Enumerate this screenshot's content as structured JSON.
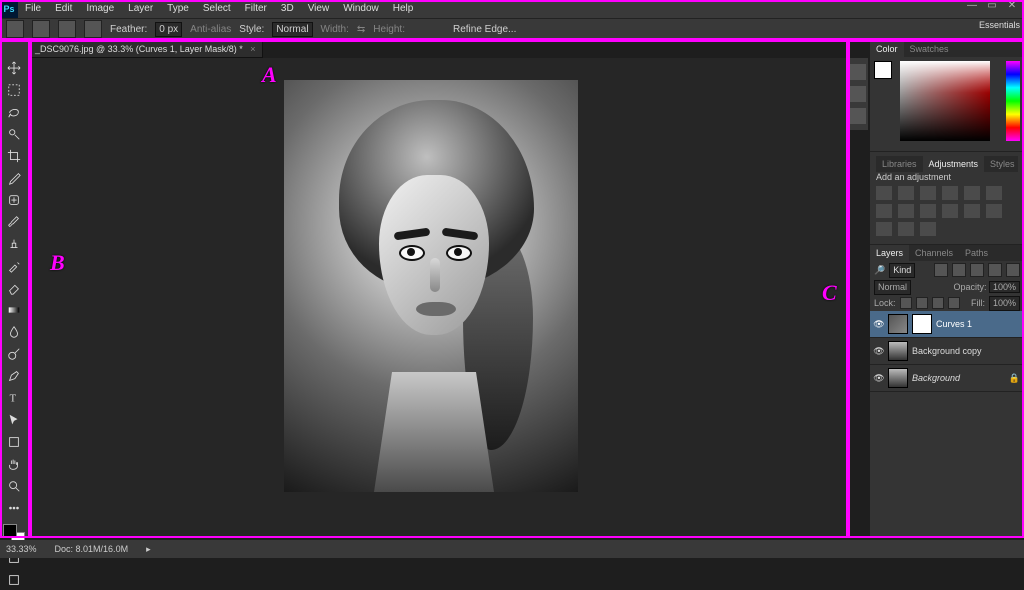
{
  "menu": [
    "File",
    "Edit",
    "Image",
    "Layer",
    "Type",
    "Select",
    "Filter",
    "3D",
    "View",
    "Window",
    "Help"
  ],
  "workspace": "Essentials",
  "options": {
    "feather_label": "Feather:",
    "feather_value": "0 px",
    "anti_alias": "Anti-alias",
    "style_label": "Style:",
    "style_value": "Normal",
    "width_label": "Width:",
    "height_label": "Height:",
    "refine": "Refine Edge..."
  },
  "doc_tab": "_DSC9076.jpg @ 33.3% (Curves 1, Layer Mask/8) *",
  "annotations": {
    "A": "A",
    "B": "B",
    "C": "C"
  },
  "iconstrip": [
    "history-icon",
    "actions-icon",
    "properties-icon"
  ],
  "color_panel": {
    "tabs": [
      "Color",
      "Swatches"
    ],
    "active": 0
  },
  "adjust_panel": {
    "tabs": [
      "Libraries",
      "Adjustments",
      "Styles"
    ],
    "active": 1,
    "heading": "Add an adjustment"
  },
  "layers_panel": {
    "tabs": [
      "Layers",
      "Channels",
      "Paths"
    ],
    "active": 0,
    "kind": "Kind",
    "blend": "Normal",
    "opacity_label": "Opacity:",
    "opacity": "100%",
    "lock_label": "Lock:",
    "fill_label": "Fill:",
    "fill": "100%",
    "layers": [
      {
        "name": "Curves 1",
        "selected": true,
        "adjust": true,
        "mask": true,
        "visible": true
      },
      {
        "name": "Background copy",
        "selected": false,
        "visible": true
      },
      {
        "name": "Background",
        "selected": false,
        "locked": true,
        "italic": true,
        "visible": true
      }
    ]
  },
  "status": {
    "zoom": "33.33%",
    "doc": "Doc: 8.01M/16.0M"
  },
  "tools": [
    "move-tool",
    "marquee-tool",
    "lasso-tool",
    "quick-select-tool",
    "crop-tool",
    "eyedropper-tool",
    "healing-brush-tool",
    "brush-tool",
    "clone-stamp-tool",
    "history-brush-tool",
    "eraser-tool",
    "gradient-tool",
    "blur-tool",
    "dodge-tool",
    "pen-tool",
    "type-tool",
    "path-select-tool",
    "shape-tool",
    "hand-tool",
    "zoom-tool",
    "edit-toolbar"
  ]
}
